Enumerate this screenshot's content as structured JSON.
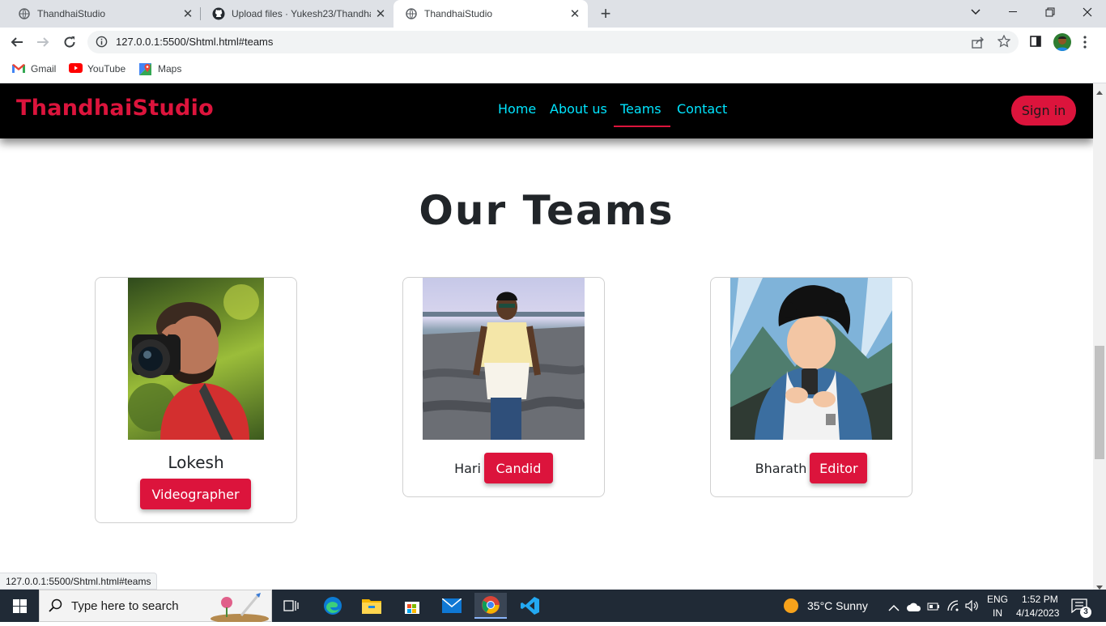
{
  "browser": {
    "tabs": [
      {
        "title": "ThandhaiStudio",
        "active": false
      },
      {
        "title": "Upload files · Yukesh23/Thandha",
        "active": false
      },
      {
        "title": "ThandhaiStudio",
        "active": true
      }
    ],
    "url": "127.0.0.1:5500/Shtml.html#teams",
    "bookmarks": [
      "Gmail",
      "YouTube",
      "Maps"
    ],
    "status_url": "127.0.0.1:5500/Shtml.html#teams"
  },
  "site": {
    "brand": "ThandhaiStudio",
    "nav": [
      "Home",
      "About us",
      "Teams",
      "Contact"
    ],
    "active_nav": "Teams",
    "signin_label": "Sign in",
    "accent_color": "#dc143c",
    "nav_color": "#00e5ff"
  },
  "teams": {
    "title": "Our Teams",
    "members": [
      {
        "name": "Lokesh",
        "role": "Videographer"
      },
      {
        "name": "Hari",
        "role": "Candid"
      },
      {
        "name": "Bharath",
        "role": "Editor"
      }
    ]
  },
  "taskbar": {
    "search_placeholder": "Type here to search",
    "weather": "35°C  Sunny",
    "lang_top": "ENG",
    "lang_bottom": "IN",
    "time": "1:52 PM",
    "date": "4/14/2023",
    "notifications": "3"
  }
}
